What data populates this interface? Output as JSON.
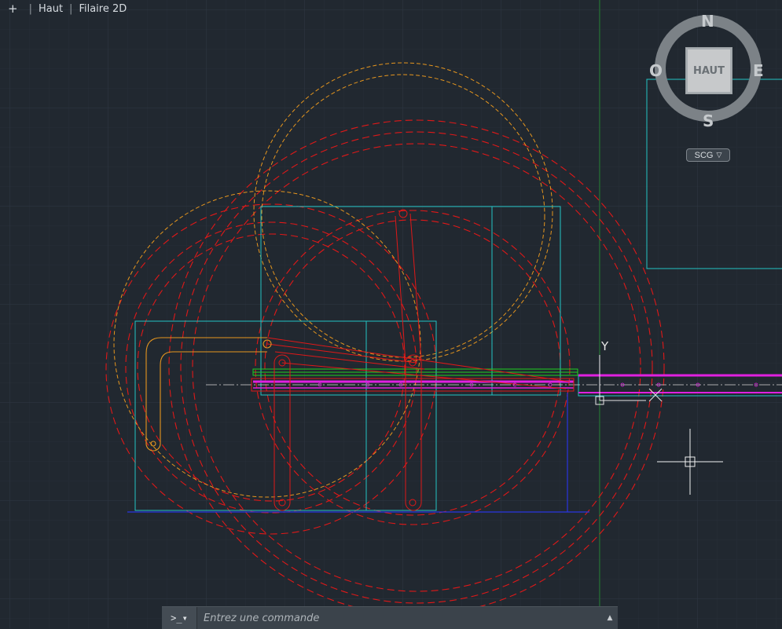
{
  "viewport_controls": {
    "plus": "+",
    "view": "Haut",
    "visual_style": "Filaire 2D"
  },
  "viewcube": {
    "face": "HAUT",
    "north": "N",
    "south": "S",
    "east": "E",
    "west": "O"
  },
  "ucs_menu": {
    "label": "SCG",
    "chevron": "▽"
  },
  "ucs_icon": {
    "y_label": "Y"
  },
  "command_line": {
    "prompt_button": ">_▾",
    "placeholder": "Entrez une commande",
    "history_icon": "▲"
  },
  "colors": {
    "background": "#212830",
    "grid_minor": "#262d36",
    "grid_major": "#2d3540",
    "cyan": "#22c5c5",
    "red": "#e01818",
    "orange": "#e6961e",
    "magenta": "#e020e0",
    "green": "#1fd01f",
    "blue": "#1e2bd0"
  }
}
